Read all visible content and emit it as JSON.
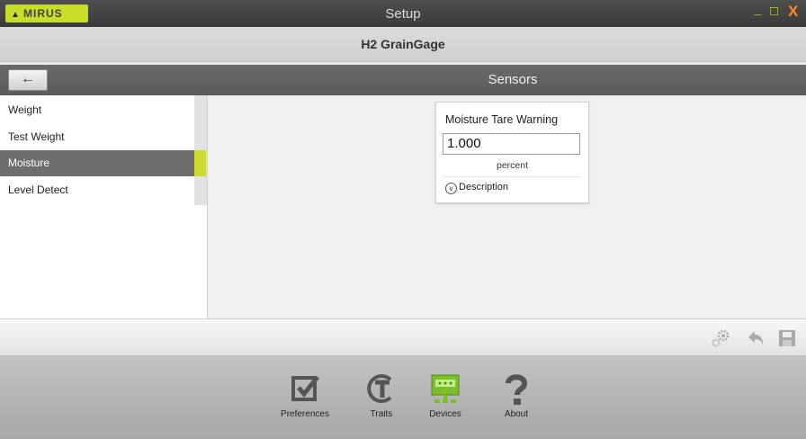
{
  "window": {
    "logo": "MIRUS",
    "title": "Setup",
    "min": "_",
    "max": "□",
    "close": "X"
  },
  "app": {
    "subtitle": "H2 GrainGage"
  },
  "nav": {
    "back": "←",
    "title": "Sensors"
  },
  "sidebar": {
    "items": [
      {
        "label": "Weight"
      },
      {
        "label": "Test Weight"
      },
      {
        "label": "Moisture"
      },
      {
        "label": "Level Detect"
      }
    ],
    "selected": "Moisture"
  },
  "card": {
    "title": "Moisture Tare Warning",
    "value": "1.000",
    "unit": "percent",
    "description": "Description"
  },
  "toolbar": {
    "icons": [
      "gears-icon",
      "undo-icon",
      "save-icon"
    ]
  },
  "bottom_nav": {
    "items": [
      {
        "label": "Preferences",
        "icon": "checkbox-icon"
      },
      {
        "label": "Traits",
        "icon": "traits-icon"
      },
      {
        "label": "Devices",
        "icon": "devices-icon"
      },
      {
        "label": "About",
        "icon": "question-icon"
      }
    ],
    "active": "Devices"
  },
  "colors": {
    "accent": "#ccd92f",
    "active_item": "#6e6e6e",
    "title_bar": "#3f3f3f"
  }
}
